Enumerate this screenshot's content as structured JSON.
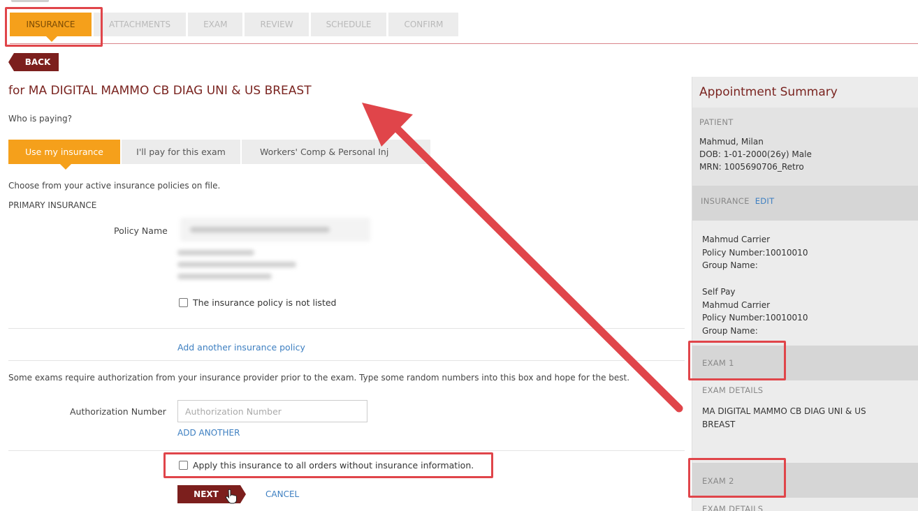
{
  "steps": [
    "INSURANCE",
    "ATTACHMENTS",
    "EXAM",
    "REVIEW",
    "SCHEDULE",
    "CONFIRM"
  ],
  "back_label": "BACK",
  "exam_title": "for MA DIGITAL MAMMO CB DIAG UNI & US BREAST",
  "who_paying": "Who is paying?",
  "pay_tabs": [
    "Use my insurance",
    "I'll pay for this exam",
    "Workers' Comp & Personal Inj"
  ],
  "choose_text": "Choose from your active insurance policies on file.",
  "primary_label": "PRIMARY INSURANCE",
  "policy_label": "Policy Name",
  "not_listed_label": "The insurance policy is not listed",
  "add_policy_link": "Add another insurance policy",
  "auth_text": "Some exams require authorization from your insurance provider prior to the exam. Type some random numbers into this box and hope for the best.",
  "auth_label": "Authorization Number",
  "auth_input": {
    "value": "",
    "placeholder": "Authorization Number"
  },
  "add_another_link": "ADD ANOTHER",
  "apply_label": "Apply this insurance to all orders without insurance information.",
  "next_label": "NEXT",
  "cancel_label": "CANCEL",
  "summary": {
    "title": "Appointment Summary",
    "patient_label": "PATIENT",
    "patient_name": "Mahmud, Milan",
    "patient_dob": "DOB: 1-01-2000(26y) Male",
    "patient_mrn": "MRN: 1005690706_Retro",
    "insurance_label": "INSURANCE",
    "edit_label": "EDIT",
    "insurance_1": "Mahmud Carrier\nPolicy Number:10010010\nGroup Name:",
    "insurance_2": "Self Pay\nMahmud Carrier\nPolicy Number:10010010\nGroup Name:",
    "exam1_label": "EXAM 1",
    "exam_details_label": "EXAM DETAILS",
    "exam1_details": "MA DIGITAL MAMMO CB DIAG UNI & US\nBREAST",
    "exam2_label": "EXAM 2",
    "exam2_details_label": "EXAM DETAILS"
  },
  "colors": {
    "accent_orange": "#f5a01b",
    "brand_maroon": "#7c1f1d",
    "link_blue": "#3d7fc1",
    "annotation_red": "#e0454a"
  }
}
